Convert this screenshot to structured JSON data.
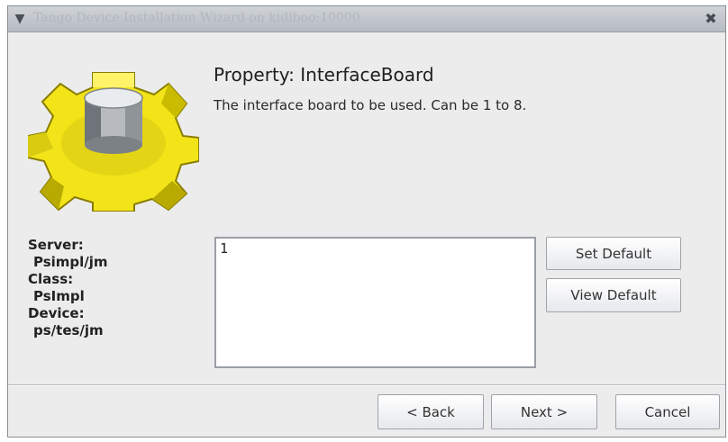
{
  "window": {
    "title": "Tango Device Installation Wizard on kidiboo:10000",
    "menu_icon": "chevron-down-icon",
    "close_icon": "close-icon"
  },
  "property": {
    "title": "Property: InterfaceBoard",
    "description": "The interface board to be used. Can be 1 to 8.",
    "value": "1"
  },
  "info": {
    "server_label": "Server:",
    "server_value": "Psimpl/jm",
    "class_label": "Class:",
    "class_value": "PsImpl",
    "device_label": "Device:",
    "device_value": "ps/tes/jm"
  },
  "buttons": {
    "set_default": "Set Default",
    "view_default": "View Default",
    "back": "< Back",
    "next": "Next >",
    "cancel": "Cancel"
  },
  "colors": {
    "gear_yellow": "#f2e419",
    "window_bg": "#ececec"
  }
}
